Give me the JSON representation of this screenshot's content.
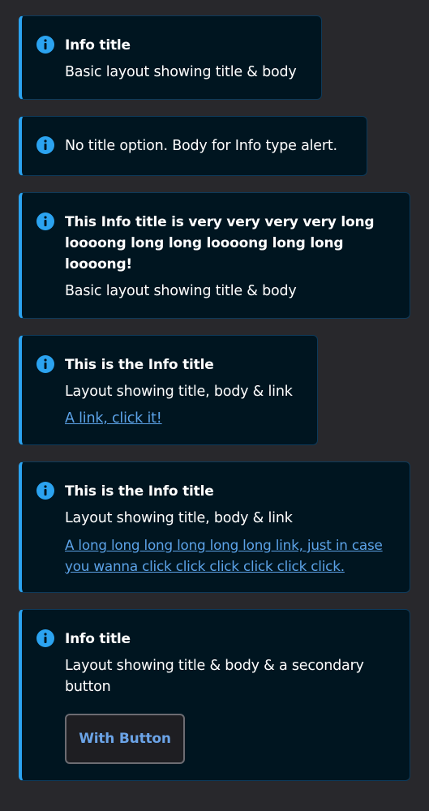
{
  "alerts": [
    {
      "title": "Info title",
      "body": "Basic layout showing title & body"
    },
    {
      "body": "No title option. Body for Info type alert."
    },
    {
      "title": "This Info title is very very very very  long loooong long long loooong long long loooong!",
      "body": "Basic layout showing title & body"
    },
    {
      "title": "This is the Info title",
      "body": "Layout showing title, body & link",
      "link": "A link, click it!"
    },
    {
      "title": "This is the Info title",
      "body": "Layout showing title, body & link",
      "link": "A long long long long long long link, just in case you wanna click click click click click click."
    },
    {
      "title": "Info title",
      "body": "Layout showing title & body & a secondary button",
      "button": "With Button"
    }
  ],
  "icon": "info-circle-icon",
  "colors": {
    "page_bg": "#28282c",
    "alert_bg": "#001520",
    "accent": "#2ba3f0",
    "link": "#5ca3e8"
  }
}
